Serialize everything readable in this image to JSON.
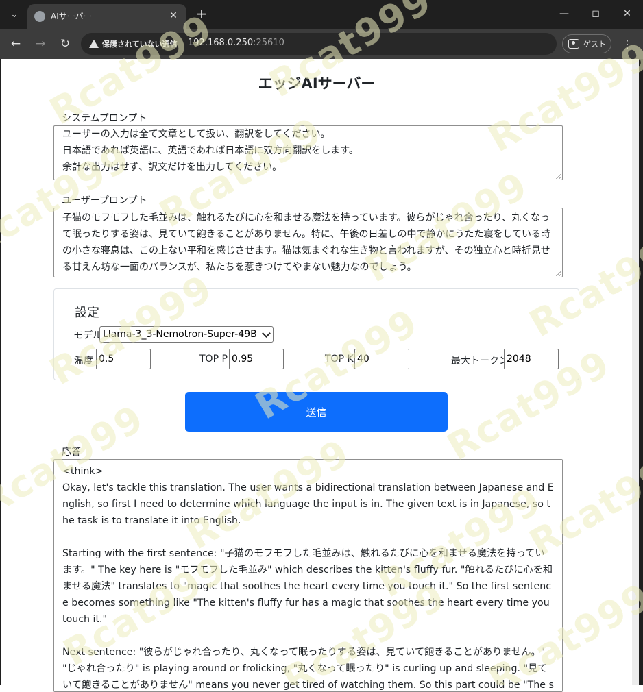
{
  "browser": {
    "tab_search_icon": "chevron-down-icon",
    "tab_title": "AIサーバー",
    "security_warning": "保護されていない通信",
    "url_host": "192.168.0.250",
    "url_port": ":25610",
    "profile_label": "ゲスト"
  },
  "page": {
    "title": "エッジAIサーバー",
    "system_prompt_label": "システムプロンプト",
    "system_prompt_value": "ユーザーの入力は全て文章として扱い、翻訳をしてください。\n日本語であれば英語に、英語であれば日本語に双方向翻訳をします。\n余計な出力はせず、訳文だけを出力してください。",
    "user_prompt_label": "ユーザープロンプト",
    "user_prompt_value": "子猫のモフモフした毛並みは、触れるたびに心を和ませる魔法を持っています。彼らがじゃれ合ったり、丸くなって眠ったりする姿は、見ていて飽きることがありません。特に、午後の日差しの中で静かにうたた寝をしている時の小さな寝息は、この上ない平和を感じさせます。猫は気まぐれな生き物と言われますが、その独立心と時折見せる甘えん坊な一面のバランスが、私たちを惹きつけてやまない魅力なのでしょう。",
    "settings": {
      "title": "設定",
      "model_label": "モデル",
      "model_value": "Llama-3_3-Nemotron-Super-49B",
      "temperature_label": "温度",
      "temperature_value": "0.5",
      "top_p_label": "TOP P",
      "top_p_value": "0.95",
      "top_k_label": "TOP K",
      "top_k_value": "40",
      "max_tokens_label": "最大トークン",
      "max_tokens_value": "2048"
    },
    "send_label": "送信",
    "response_label": "応答",
    "response_value": "<think>\nOkay, let's tackle this translation. The user wants a bidirectional translation between Japanese and English, so first I need to determine which language the input is in. The given text is in Japanese, so the task is to translate it into English.\n\nStarting with the first sentence: \"子猫のモフモフした毛並みは、触れるたびに心を和ませる魔法を持っています。\" The key here is \"モフモフした毛並み\" which describes the kitten's fluffy fur. \"触れるたびに心を和ませる魔法\" translates to \"magic that soothes the heart every time you touch it.\" So the first sentence becomes something like \"The kitten's fluffy fur has a magic that soothes the heart every time you touch it.\"\n\nNext sentence: \"彼らがじゃれ合ったり、丸くなって眠ったりする姿は、見ていて飽きることがありません。\" \"じゃれ合ったり\" is playing around or frolicking, \"丸くなって眠ったり\" is curling up and sleeping. \"見ていて飽きることがありません\" means you never get tired of watching them. So this part could be \"The sight of them playing around or curling up to sleep is endlessly captivating.\""
  },
  "watermark": "Rcat999"
}
